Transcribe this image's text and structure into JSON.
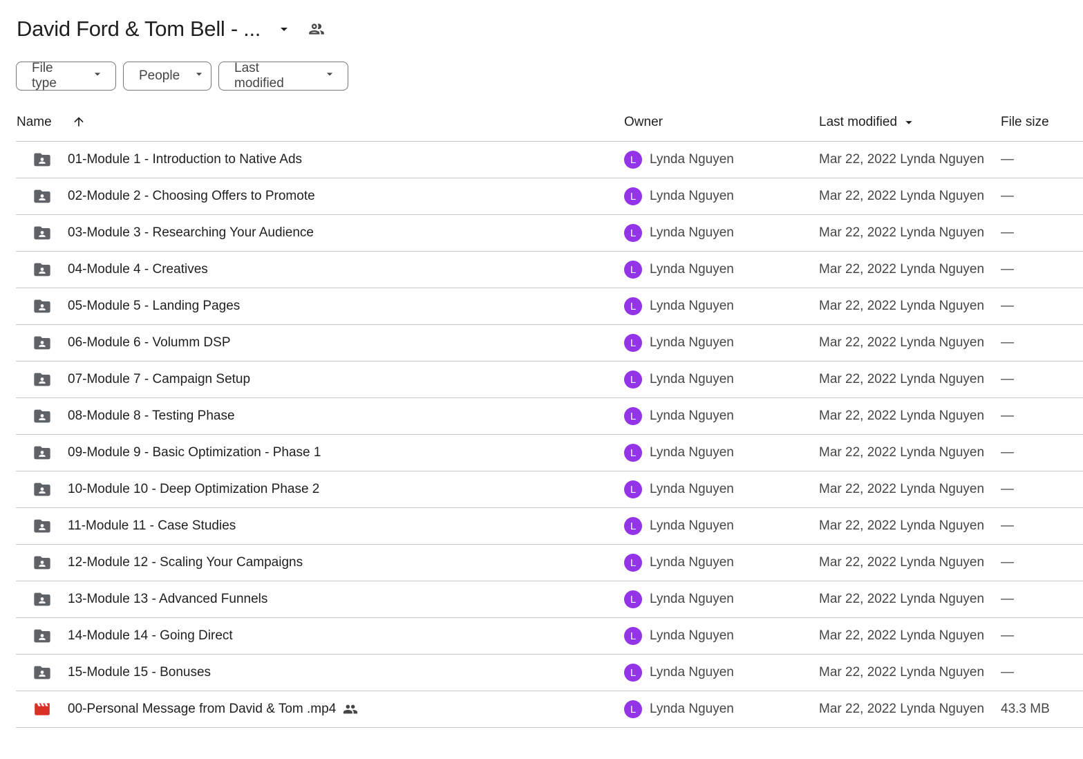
{
  "header": {
    "title": "David Ford & Tom Bell - ...",
    "caret_icon": "arrow-drop-down-icon",
    "shared_icon": "people-outline-icon"
  },
  "filters": [
    {
      "label": "File type"
    },
    {
      "label": "People"
    },
    {
      "label": "Last modified"
    }
  ],
  "columns": {
    "name": "Name",
    "owner": "Owner",
    "last_modified": "Last modified",
    "file_size": "File size"
  },
  "files": [
    {
      "name": "01-Module 1 - Introduction to Native Ads",
      "type": "shared-folder",
      "owner": "Lynda Nguyen",
      "owner_initial": "L",
      "modified": "Mar 22, 2022 Lynda Nguyen",
      "size": "—"
    },
    {
      "name": "02-Module 2 - Choosing Offers to Promote",
      "type": "shared-folder",
      "owner": "Lynda Nguyen",
      "owner_initial": "L",
      "modified": "Mar 22, 2022 Lynda Nguyen",
      "size": "—"
    },
    {
      "name": "03-Module 3 - Researching Your Audience",
      "type": "shared-folder",
      "owner": "Lynda Nguyen",
      "owner_initial": "L",
      "modified": "Mar 22, 2022 Lynda Nguyen",
      "size": "—"
    },
    {
      "name": "04-Module 4 - Creatives",
      "type": "shared-folder",
      "owner": "Lynda Nguyen",
      "owner_initial": "L",
      "modified": "Mar 22, 2022 Lynda Nguyen",
      "size": "—"
    },
    {
      "name": "05-Module 5 - Landing Pages",
      "type": "shared-folder",
      "owner": "Lynda Nguyen",
      "owner_initial": "L",
      "modified": "Mar 22, 2022 Lynda Nguyen",
      "size": "—"
    },
    {
      "name": "06-Module 6 - Volumm DSP",
      "type": "shared-folder",
      "owner": "Lynda Nguyen",
      "owner_initial": "L",
      "modified": "Mar 22, 2022 Lynda Nguyen",
      "size": "—"
    },
    {
      "name": "07-Module 7 - Campaign Setup",
      "type": "shared-folder",
      "owner": "Lynda Nguyen",
      "owner_initial": "L",
      "modified": "Mar 22, 2022 Lynda Nguyen",
      "size": "—"
    },
    {
      "name": "08-Module 8 - Testing Phase",
      "type": "shared-folder",
      "owner": "Lynda Nguyen",
      "owner_initial": "L",
      "modified": "Mar 22, 2022 Lynda Nguyen",
      "size": "—"
    },
    {
      "name": "09-Module 9 - Basic Optimization - Phase 1",
      "type": "shared-folder",
      "owner": "Lynda Nguyen",
      "owner_initial": "L",
      "modified": "Mar 22, 2022 Lynda Nguyen",
      "size": "—"
    },
    {
      "name": "10-Module 10 - Deep Optimization Phase 2",
      "type": "shared-folder",
      "owner": "Lynda Nguyen",
      "owner_initial": "L",
      "modified": "Mar 22, 2022 Lynda Nguyen",
      "size": "—"
    },
    {
      "name": "11-Module 11 - Case Studies",
      "type": "shared-folder",
      "owner": "Lynda Nguyen",
      "owner_initial": "L",
      "modified": "Mar 22, 2022 Lynda Nguyen",
      "size": "—"
    },
    {
      "name": "12-Module 12 - Scaling Your Campaigns",
      "type": "shared-folder",
      "owner": "Lynda Nguyen",
      "owner_initial": "L",
      "modified": "Mar 22, 2022 Lynda Nguyen",
      "size": "—"
    },
    {
      "name": "13-Module 13 - Advanced Funnels",
      "type": "shared-folder",
      "owner": "Lynda Nguyen",
      "owner_initial": "L",
      "modified": "Mar 22, 2022 Lynda Nguyen",
      "size": "—"
    },
    {
      "name": "14-Module 14 - Going Direct",
      "type": "shared-folder",
      "owner": "Lynda Nguyen",
      "owner_initial": "L",
      "modified": "Mar 22, 2022 Lynda Nguyen",
      "size": "—"
    },
    {
      "name": "15-Module 15 - Bonuses",
      "type": "shared-folder",
      "owner": "Lynda Nguyen",
      "owner_initial": "L",
      "modified": "Mar 22, 2022 Lynda Nguyen",
      "size": "—"
    },
    {
      "name": "00-Personal Message from David & Tom .mp4",
      "type": "video",
      "shared": true,
      "owner": "Lynda Nguyen",
      "owner_initial": "L",
      "modified": "Mar 22, 2022 Lynda Nguyen",
      "size": "43.3 MB"
    }
  ],
  "colors": {
    "avatar": "#9334e6",
    "folder_icon": "#5f6368",
    "video_icon": "#d93025",
    "divider": "#c7c7c7"
  }
}
